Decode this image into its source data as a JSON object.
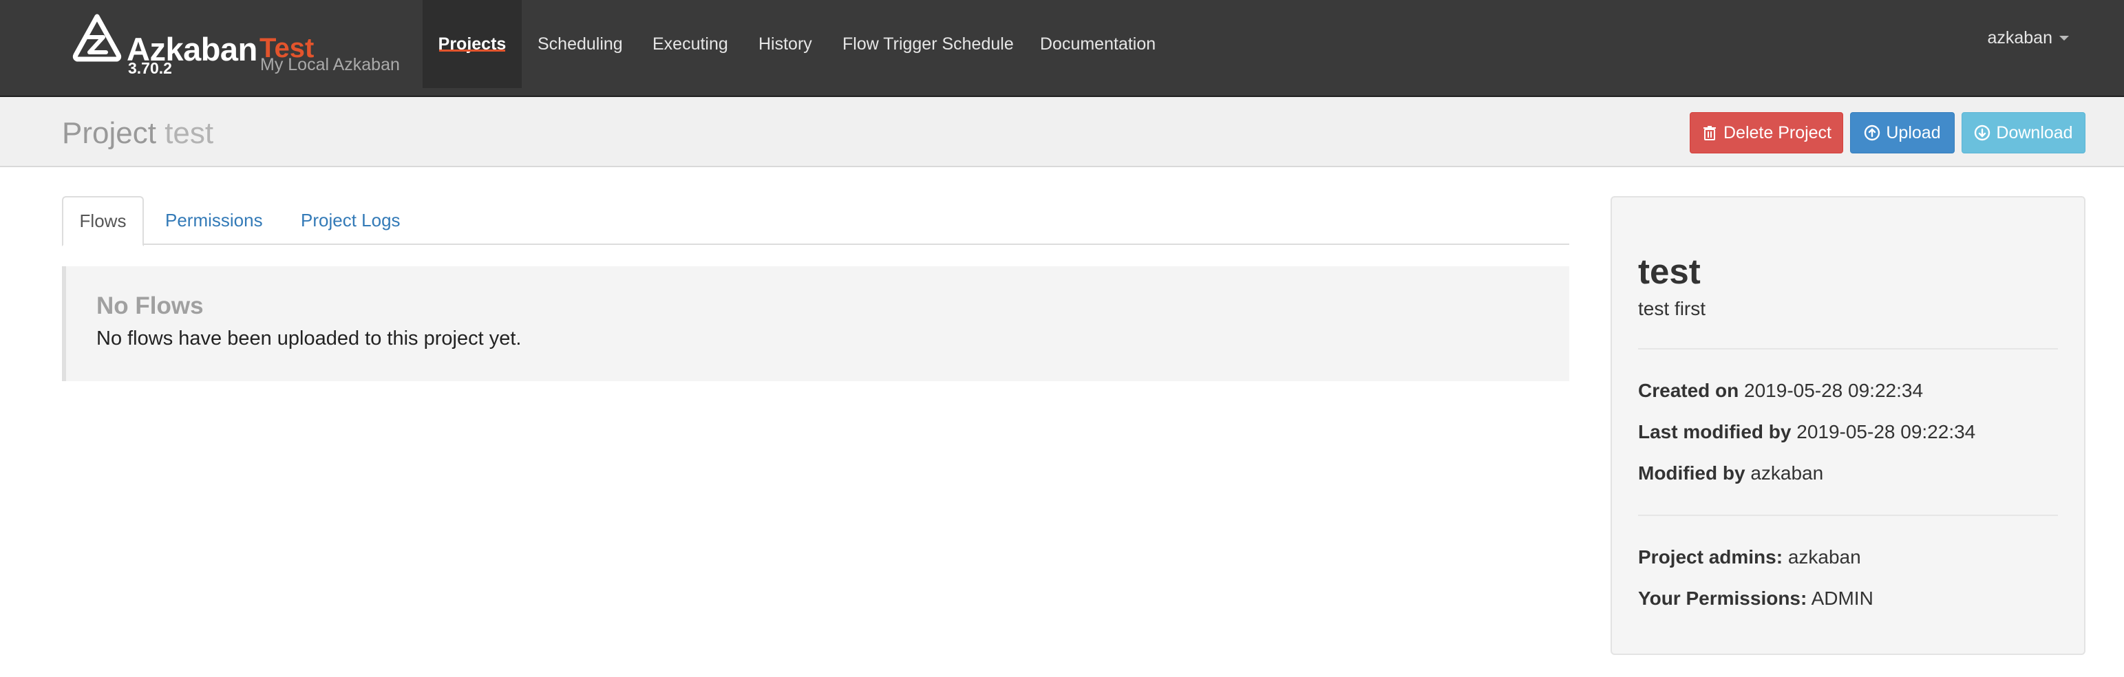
{
  "navbar": {
    "brand": "Azkaban",
    "environment": "Test",
    "version": "3.70.2",
    "subtitle": "My Local Azkaban",
    "items": [
      "Projects",
      "Scheduling",
      "Executing",
      "History",
      "Flow Trigger Schedule",
      "Documentation"
    ],
    "active_item": "Projects",
    "user": "azkaban",
    "accent_color": "#e3542c"
  },
  "header": {
    "title_prefix": "Project",
    "project_name": "test",
    "buttons": {
      "delete": "Delete Project",
      "upload": "Upload",
      "download": "Download"
    }
  },
  "tabs": [
    "Flows",
    "Permissions",
    "Project Logs"
  ],
  "active_tab": "Flows",
  "flows": {
    "empty_title": "No Flows",
    "empty_text": "No flows have been uploaded to this project yet."
  },
  "project_info": {
    "name": "test",
    "description": "test first",
    "created_label": "Created on",
    "created_value": "2019-05-28 09:22:34",
    "modified_label": "Last modified by",
    "modified_value": "2019-05-28 09:22:34",
    "modified_by_label": "Modified by",
    "modified_by_value": "azkaban",
    "admins_label": "Project admins:",
    "admins_value": "azkaban",
    "permissions_label": "Your Permissions:",
    "permissions_value": "ADMIN"
  }
}
